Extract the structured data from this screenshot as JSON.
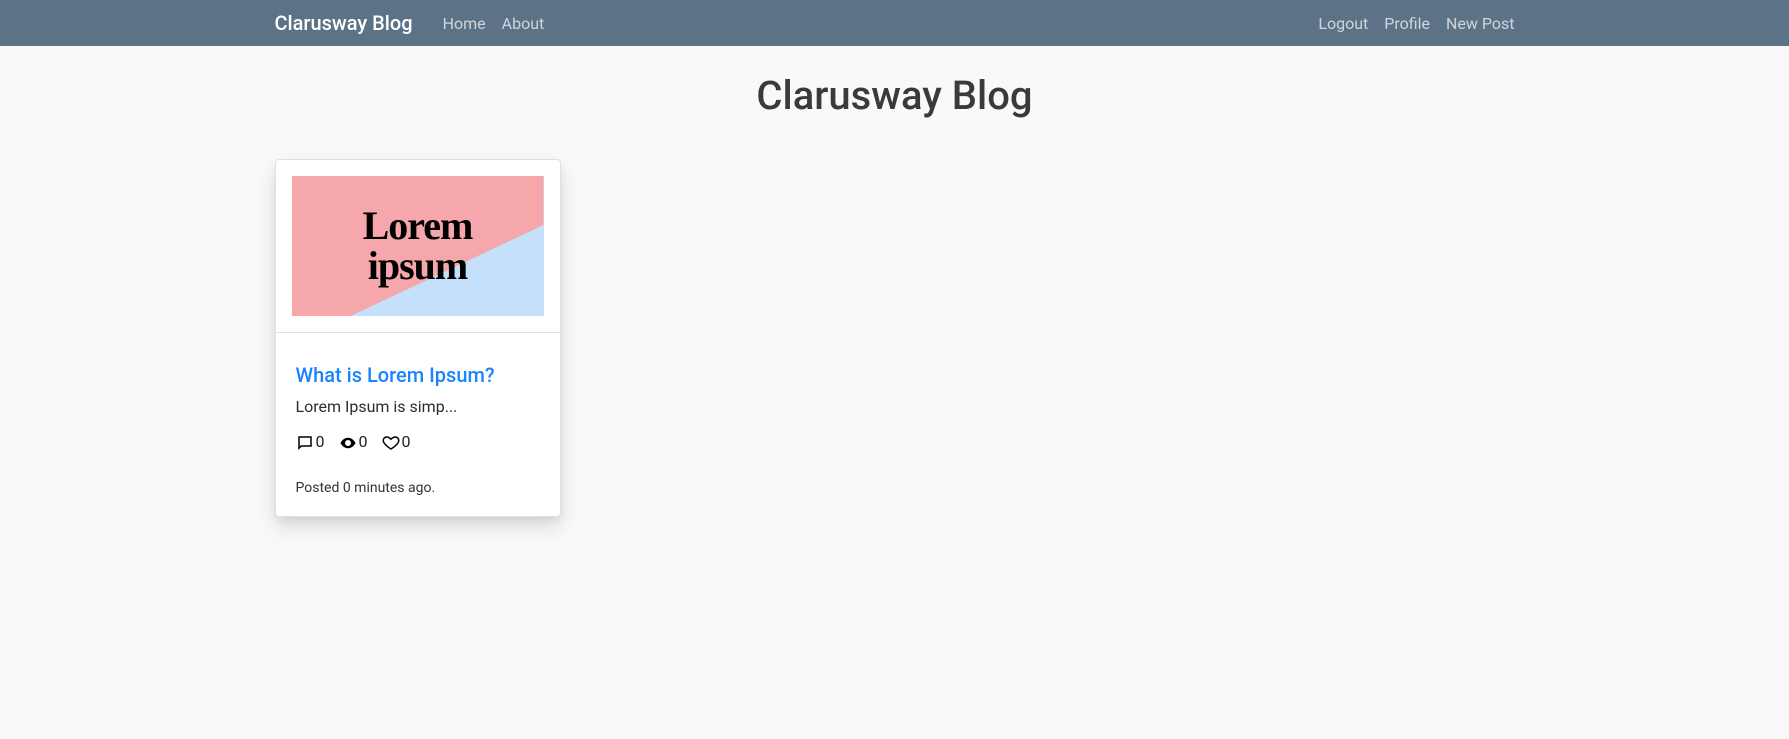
{
  "navbar": {
    "brand": "Clarusway Blog",
    "left_links": [
      {
        "label": "Home"
      },
      {
        "label": "About"
      }
    ],
    "right_links": [
      {
        "label": "Logout"
      },
      {
        "label": "Profile"
      },
      {
        "label": "New Post"
      }
    ]
  },
  "page": {
    "title": "Clarusway Blog"
  },
  "posts": [
    {
      "image_text_line1": "Lorem",
      "image_text_line2": "ipsum",
      "title": "What is Lorem Ipsum?",
      "excerpt": "Lorem Ipsum is simp...",
      "comments": "0",
      "views": "0",
      "likes": "0",
      "posted": "Posted 0 minutes ago."
    }
  ]
}
